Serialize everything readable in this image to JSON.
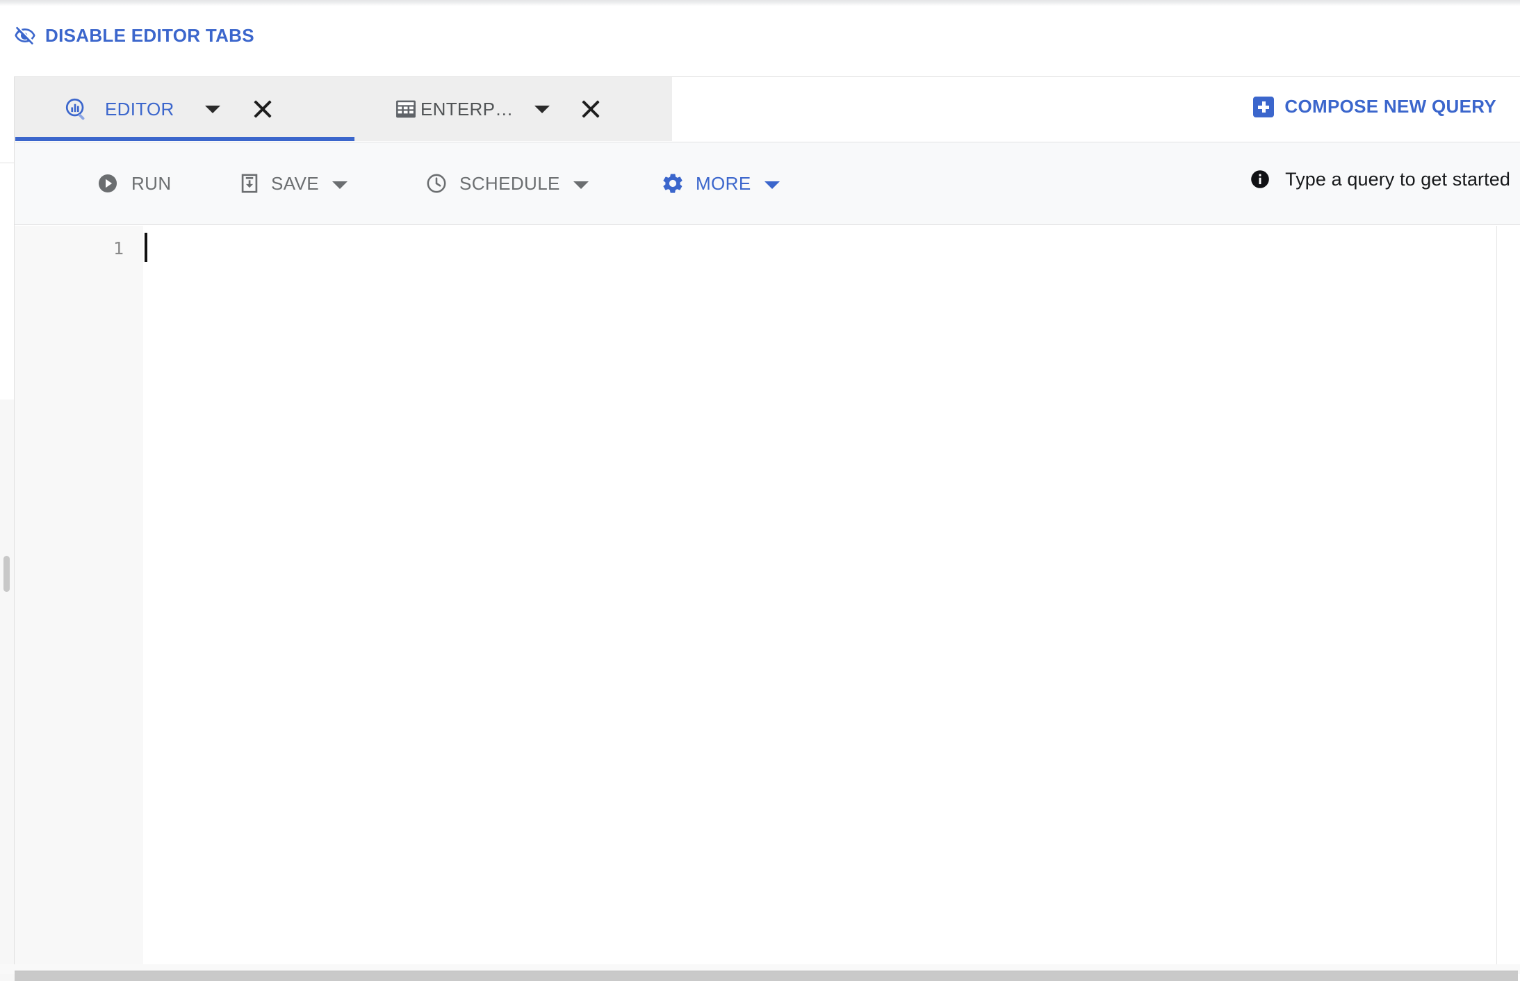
{
  "header": {
    "disable_editor_tabs": {
      "label": "DISABLE EDITOR TABS",
      "icon": "eye-off-icon",
      "color": "#3b66cc"
    }
  },
  "tabstrip": {
    "tabs": [
      {
        "label": "EDITOR",
        "icon": "query-editor-icon",
        "active": true,
        "has_menu_caret": true,
        "has_close": true
      },
      {
        "label": "ENTERP…",
        "icon": "table-grid-icon",
        "active": false,
        "has_menu_caret": true,
        "has_close": true
      }
    ],
    "compose": {
      "label": "COMPOSE NEW QUERY",
      "icon": "plus-box-icon"
    },
    "active_color": "#3b66cc",
    "inactive_color": "#515456",
    "strip_background": "#eeeeee"
  },
  "toolbar": {
    "run": {
      "label": "RUN",
      "icon": "play-circle-icon",
      "enabled": false
    },
    "save": {
      "label": "SAVE",
      "icon": "save-icon",
      "has_caret": true,
      "enabled": false
    },
    "schedule": {
      "label": "SCHEDULE",
      "icon": "clock-icon",
      "has_caret": true,
      "enabled": false
    },
    "more": {
      "label": "MORE",
      "icon": "gear-icon",
      "has_caret": true,
      "enabled": true,
      "color": "#3b66cc"
    },
    "status": {
      "icon": "info-circle-icon",
      "text": "Type a query to get started"
    },
    "background": "#f8f9fa"
  },
  "editor": {
    "line_numbers": [
      "1"
    ],
    "content": "",
    "cursor_line": 1,
    "cursor_column": 1,
    "gutter_background": "#f8f8f8"
  },
  "scrollbars": {
    "horizontal_present": true,
    "vertical_handle_present": true
  }
}
